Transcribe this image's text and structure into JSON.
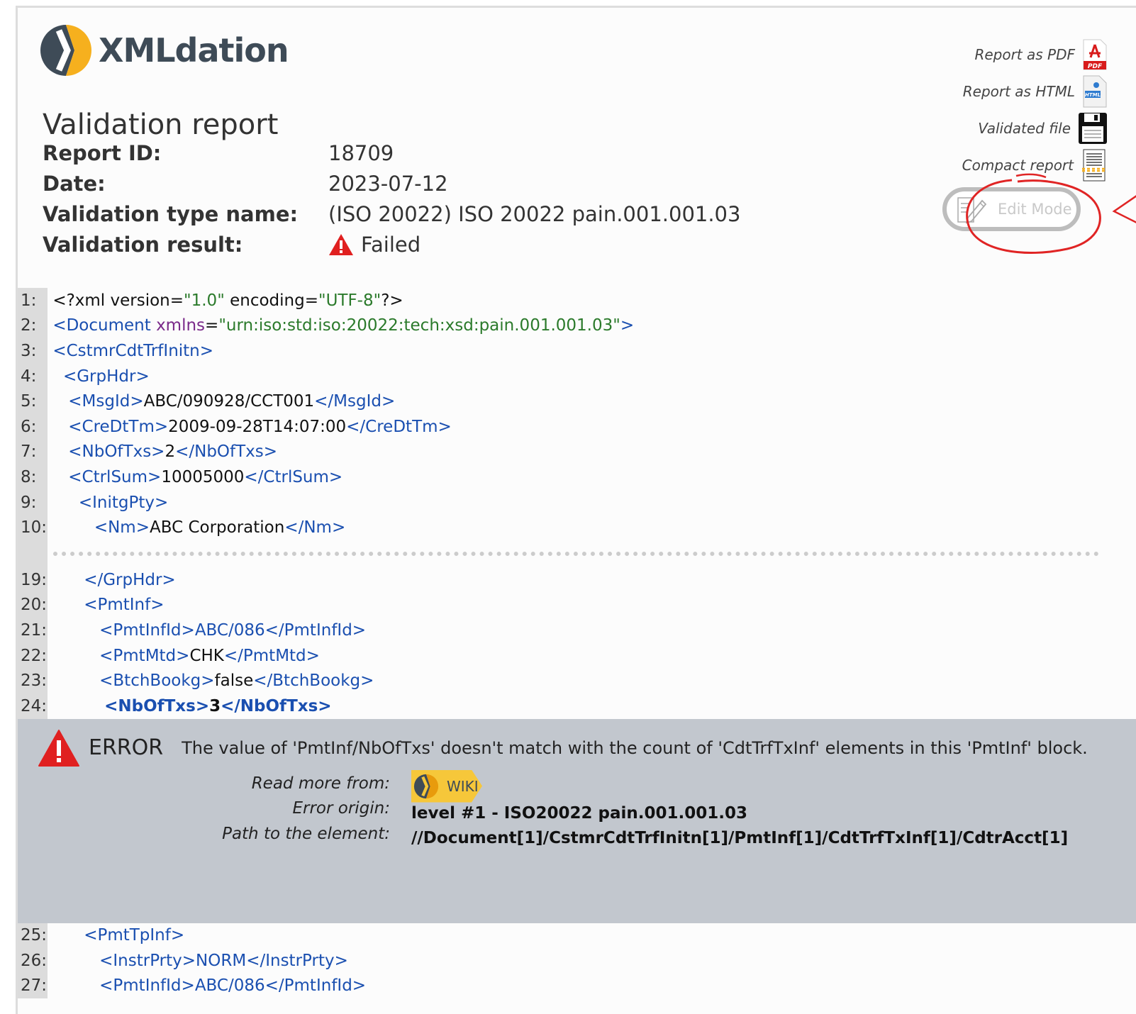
{
  "logo": {
    "text": "XMLdation"
  },
  "title": "Validation report",
  "meta": {
    "report_id_label": "Report ID:",
    "report_id": "18709",
    "date_label": "Date:",
    "date": "2023-07-12",
    "type_label": "Validation type name:",
    "type": "(ISO 20022) ISO 20022 pain.001.001.03",
    "result_label": "Validation result:",
    "result": "Failed"
  },
  "actions": {
    "pdf": "Report as PDF",
    "html": "Report as HTML",
    "file": "Validated file",
    "compact": "Compact report",
    "edit_mode": "Edit Mode"
  },
  "code_lines_top": [
    {
      "n": "1:",
      "indent": "",
      "parts": [
        [
          "txt",
          "<?xml version="
        ],
        [
          "str",
          "\"1.0\""
        ],
        [
          "txt",
          " encoding="
        ],
        [
          "str",
          "\"UTF-8\""
        ],
        [
          "txt",
          "?>"
        ]
      ]
    },
    {
      "n": "2:",
      "indent": "",
      "parts": [
        [
          "tag",
          "<Document "
        ],
        [
          "attr",
          "xmlns"
        ],
        [
          "txt",
          "="
        ],
        [
          "str",
          "\"urn:iso:std:iso:20022:tech:xsd:pain.001.001.03\""
        ],
        [
          "tag",
          ">"
        ]
      ]
    },
    {
      "n": "3:",
      "indent": "",
      "parts": [
        [
          "tag",
          "<CstmrCdtTrfInitn>"
        ]
      ]
    },
    {
      "n": "4:",
      "indent": "  ",
      "parts": [
        [
          "tag",
          "<GrpHdr>"
        ]
      ]
    },
    {
      "n": "5:",
      "indent": "   ",
      "parts": [
        [
          "tag",
          "<MsgId>"
        ],
        [
          "txt",
          "ABC/090928/CCT001"
        ],
        [
          "tag",
          "</MsgId>"
        ]
      ]
    },
    {
      "n": "6:",
      "indent": "   ",
      "parts": [
        [
          "tag",
          "<CreDtTm>"
        ],
        [
          "txt",
          "2009-09-28T14:07:00"
        ],
        [
          "tag",
          "</CreDtTm>"
        ]
      ]
    },
    {
      "n": "7:",
      "indent": "   ",
      "parts": [
        [
          "tag",
          "<NbOfTxs>"
        ],
        [
          "txt",
          "2"
        ],
        [
          "tag",
          "</NbOfTxs>"
        ]
      ]
    },
    {
      "n": "8:",
      "indent": "   ",
      "parts": [
        [
          "tag",
          "<CtrlSum>"
        ],
        [
          "txt",
          "10005000"
        ],
        [
          "tag",
          "</CtrlSum>"
        ]
      ]
    },
    {
      "n": "9:",
      "indent": "     ",
      "parts": [
        [
          "tag",
          "<InitgPty>"
        ]
      ]
    },
    {
      "n": "10:",
      "indent": "        ",
      "parts": [
        [
          "tag",
          "<Nm>"
        ],
        [
          "txt",
          "ABC Corporation"
        ],
        [
          "tag",
          "</Nm>"
        ]
      ]
    }
  ],
  "code_lines_mid": [
    {
      "n": "19:",
      "indent": "      ",
      "parts": [
        [
          "tag",
          "</GrpHdr>"
        ]
      ]
    },
    {
      "n": "20:",
      "indent": "      ",
      "parts": [
        [
          "tag",
          "<PmtInf>"
        ]
      ]
    },
    {
      "n": "21:",
      "indent": "         ",
      "parts": [
        [
          "tag",
          "<PmtInfId>"
        ],
        [
          "tag",
          "ABC/086"
        ],
        [
          "tag",
          "</PmtInfId>"
        ]
      ]
    },
    {
      "n": "22:",
      "indent": "         ",
      "parts": [
        [
          "tag",
          "<PmtMtd>"
        ],
        [
          "txt",
          "CHK"
        ],
        [
          "tag",
          "</PmtMtd>"
        ]
      ]
    },
    {
      "n": "23:",
      "indent": "         ",
      "parts": [
        [
          "tag",
          "<BtchBookg>"
        ],
        [
          "txt",
          "false"
        ],
        [
          "tag",
          "</BtchBookg>"
        ]
      ]
    },
    {
      "n": "24:",
      "indent": "         ",
      "bold": true,
      "parts": [
        [
          "tag",
          "<NbOfTxs>"
        ],
        [
          "txt",
          "3"
        ],
        [
          "tag",
          "</NbOfTxs>"
        ]
      ]
    }
  ],
  "error": {
    "word": "ERROR",
    "message": "The value of 'PmtInf/NbOfTxs' doesn't match with the count of 'CdtTrfTxInf' elements in this 'PmtInf' block.",
    "read_more_label": "Read more from:",
    "wiki_label": "WIKI",
    "origin_label": "Error origin:",
    "origin": "level #1 - ISO20022 pain.001.001.03",
    "path_label": "Path to the element:",
    "path": "//Document[1]/CstmrCdtTrfInitn[1]/PmtInf[1]/CdtTrfTxInf[1]/CdtrAcct[1]"
  },
  "code_lines_bottom": [
    {
      "n": "25:",
      "indent": "      ",
      "parts": [
        [
          "tag",
          "<PmtTpInf>"
        ]
      ]
    },
    {
      "n": "26:",
      "indent": "         ",
      "parts": [
        [
          "tag",
          "<InstrPrty>"
        ],
        [
          "tag",
          "NORM"
        ],
        [
          "tag",
          "</InstrPrty>"
        ]
      ]
    },
    {
      "n": "27:",
      "indent": "         ",
      "parts": [
        [
          "tag",
          "<PmtInfId>"
        ],
        [
          "tag",
          "ABC/086"
        ],
        [
          "tag",
          "</PmtInfId>"
        ]
      ]
    }
  ],
  "colors": {
    "tag": "#1a4fb0",
    "attr": "#7a2a8a",
    "string": "#2b7a2b",
    "error_bg": "#c2c7ce",
    "accent": "#f6c73a",
    "danger": "#e02020"
  },
  "icons": [
    "xmldation-logo-icon",
    "pdf-icon",
    "html-file-icon",
    "floppy-disk-icon",
    "compact-report-icon",
    "edit-pencil-icon",
    "warning-icon"
  ]
}
